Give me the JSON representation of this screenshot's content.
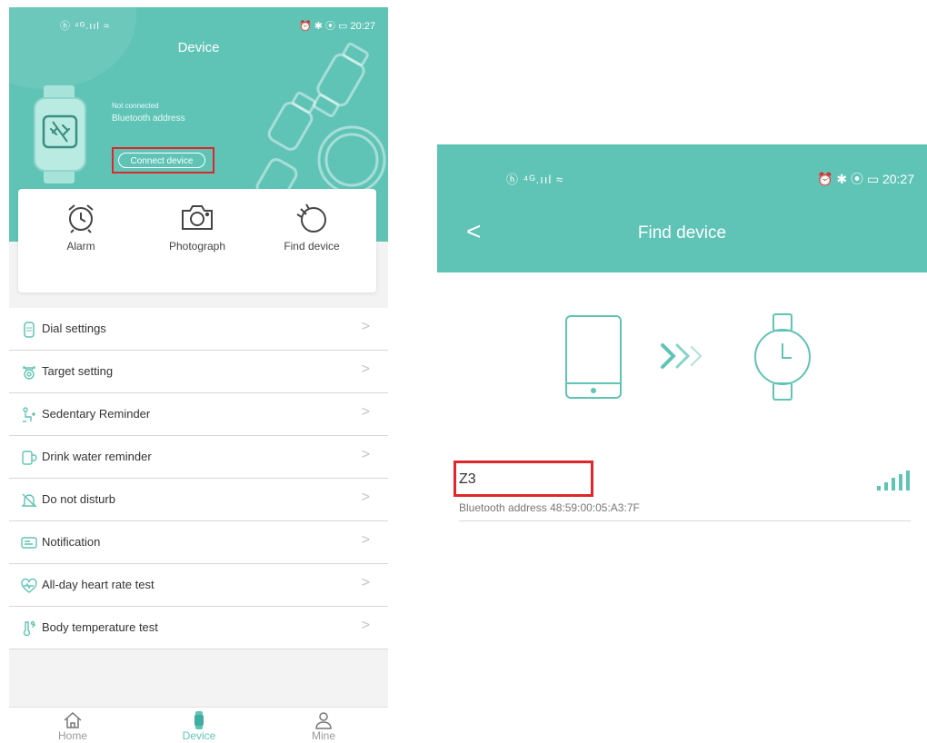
{
  "left": {
    "status_bar": {
      "left": "ⓗ ⁴ᴳ.ııl ≈",
      "right": "⏰ ✱ ⦿ ▭ 20:27"
    },
    "title": "Device",
    "connection_status": "Not connected",
    "bluetooth_label": "Bluetooth address",
    "connect_button": "Connect device",
    "quick_actions": [
      {
        "label": "Alarm",
        "icon": "alarm-clock-icon"
      },
      {
        "label": "Photograph",
        "icon": "camera-icon"
      },
      {
        "label": "Find device",
        "icon": "find-device-icon"
      }
    ],
    "menu": [
      {
        "label": "Dial settings",
        "icon": "watch-face-icon"
      },
      {
        "label": "Target setting",
        "icon": "target-icon"
      },
      {
        "label": "Sedentary Reminder",
        "icon": "sedentary-icon"
      },
      {
        "label": "Drink water reminder",
        "icon": "cup-icon"
      },
      {
        "label": "Do not disturb",
        "icon": "bell-off-icon"
      },
      {
        "label": "Notification",
        "icon": "message-icon"
      },
      {
        "label": "All-day heart rate test",
        "icon": "heart-rate-icon"
      },
      {
        "label": "Body temperature test",
        "icon": "thermometer-icon"
      }
    ],
    "chevron": ">",
    "tabs": [
      {
        "label": "Home",
        "icon": "home-icon",
        "active": false
      },
      {
        "label": "Device",
        "icon": "watch-icon",
        "active": true
      },
      {
        "label": "Mine",
        "icon": "person-icon",
        "active": false
      }
    ]
  },
  "right": {
    "status_bar": {
      "left": "ⓗ ⁴ᴳ.ııl ≈",
      "right": "⏰ ✱ ⦿ ▭ 20:27"
    },
    "back": "<",
    "title": "Find device",
    "device_name": "Z3",
    "bluetooth_label": "Bluetooth address",
    "bluetooth_address": "48:59:00:05:A3:7F"
  },
  "colors": {
    "accent": "#5fc4b6",
    "highlight_box": "#e0252b",
    "chevron": "#c3c3c3"
  }
}
